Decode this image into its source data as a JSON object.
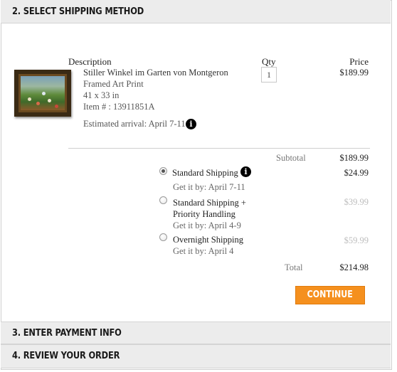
{
  "steps": {
    "shipping": "2. Select Shipping Method",
    "payment": "3. Enter Payment Info",
    "review": "4. Review Your Order"
  },
  "columns": {
    "description": "Description",
    "qty": "Qty",
    "price": "Price"
  },
  "item": {
    "name": "Stiller Winkel im Garten von Montgeron",
    "type": "Framed Art Print",
    "size": "41 x 33 in",
    "item_number": "Item # : 13911851A",
    "arrival": "Estimated arrival: April 7-11",
    "qty": "1",
    "price": "$189.99"
  },
  "subtotal": {
    "label": "Subtotal",
    "value": "$189.99"
  },
  "shipping_options": [
    {
      "label": "Standard Shipping",
      "eta": "Get it by: April 7-11",
      "price": "$24.99",
      "selected": true
    },
    {
      "label_line1": "Standard Shipping +",
      "label_line2": "Priority Handling",
      "eta": "Get it by: April 4-9",
      "price": "$39.99",
      "selected": false
    },
    {
      "label": "Overnight Shipping",
      "eta": "Get it by: April 4",
      "price": "$59.99",
      "selected": false
    }
  ],
  "total": {
    "label": "Total",
    "value": "$214.98"
  },
  "continue_label": "Continue",
  "icons": {
    "info": "info-icon",
    "radio": "radio-icon"
  },
  "colors": {
    "accent": "#f5901e",
    "header_bg": "#ececec"
  }
}
